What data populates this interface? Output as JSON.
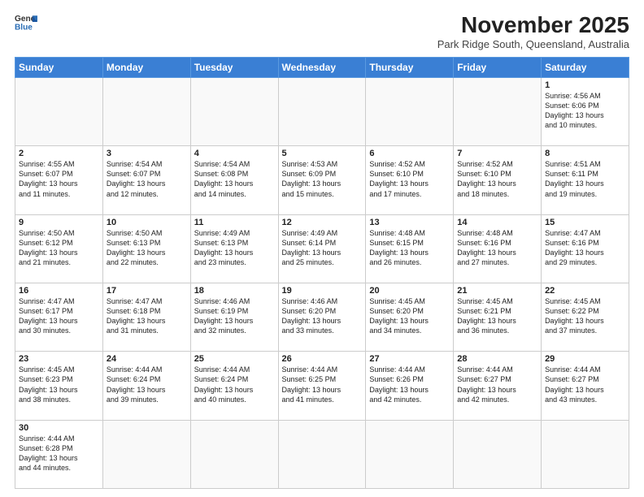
{
  "header": {
    "logo_general": "General",
    "logo_blue": "Blue",
    "month_title": "November 2025",
    "location": "Park Ridge South, Queensland, Australia"
  },
  "weekdays": [
    "Sunday",
    "Monday",
    "Tuesday",
    "Wednesday",
    "Thursday",
    "Friday",
    "Saturday"
  ],
  "weeks": [
    [
      {
        "day": "",
        "info": ""
      },
      {
        "day": "",
        "info": ""
      },
      {
        "day": "",
        "info": ""
      },
      {
        "day": "",
        "info": ""
      },
      {
        "day": "",
        "info": ""
      },
      {
        "day": "",
        "info": ""
      },
      {
        "day": "1",
        "info": "Sunrise: 4:56 AM\nSunset: 6:06 PM\nDaylight: 13 hours\nand 10 minutes."
      }
    ],
    [
      {
        "day": "2",
        "info": "Sunrise: 4:55 AM\nSunset: 6:07 PM\nDaylight: 13 hours\nand 11 minutes."
      },
      {
        "day": "3",
        "info": "Sunrise: 4:54 AM\nSunset: 6:07 PM\nDaylight: 13 hours\nand 12 minutes."
      },
      {
        "day": "4",
        "info": "Sunrise: 4:54 AM\nSunset: 6:08 PM\nDaylight: 13 hours\nand 14 minutes."
      },
      {
        "day": "5",
        "info": "Sunrise: 4:53 AM\nSunset: 6:09 PM\nDaylight: 13 hours\nand 15 minutes."
      },
      {
        "day": "6",
        "info": "Sunrise: 4:52 AM\nSunset: 6:10 PM\nDaylight: 13 hours\nand 17 minutes."
      },
      {
        "day": "7",
        "info": "Sunrise: 4:52 AM\nSunset: 6:10 PM\nDaylight: 13 hours\nand 18 minutes."
      },
      {
        "day": "8",
        "info": "Sunrise: 4:51 AM\nSunset: 6:11 PM\nDaylight: 13 hours\nand 19 minutes."
      }
    ],
    [
      {
        "day": "9",
        "info": "Sunrise: 4:50 AM\nSunset: 6:12 PM\nDaylight: 13 hours\nand 21 minutes."
      },
      {
        "day": "10",
        "info": "Sunrise: 4:50 AM\nSunset: 6:13 PM\nDaylight: 13 hours\nand 22 minutes."
      },
      {
        "day": "11",
        "info": "Sunrise: 4:49 AM\nSunset: 6:13 PM\nDaylight: 13 hours\nand 23 minutes."
      },
      {
        "day": "12",
        "info": "Sunrise: 4:49 AM\nSunset: 6:14 PM\nDaylight: 13 hours\nand 25 minutes."
      },
      {
        "day": "13",
        "info": "Sunrise: 4:48 AM\nSunset: 6:15 PM\nDaylight: 13 hours\nand 26 minutes."
      },
      {
        "day": "14",
        "info": "Sunrise: 4:48 AM\nSunset: 6:16 PM\nDaylight: 13 hours\nand 27 minutes."
      },
      {
        "day": "15",
        "info": "Sunrise: 4:47 AM\nSunset: 6:16 PM\nDaylight: 13 hours\nand 29 minutes."
      }
    ],
    [
      {
        "day": "16",
        "info": "Sunrise: 4:47 AM\nSunset: 6:17 PM\nDaylight: 13 hours\nand 30 minutes."
      },
      {
        "day": "17",
        "info": "Sunrise: 4:47 AM\nSunset: 6:18 PM\nDaylight: 13 hours\nand 31 minutes."
      },
      {
        "day": "18",
        "info": "Sunrise: 4:46 AM\nSunset: 6:19 PM\nDaylight: 13 hours\nand 32 minutes."
      },
      {
        "day": "19",
        "info": "Sunrise: 4:46 AM\nSunset: 6:20 PM\nDaylight: 13 hours\nand 33 minutes."
      },
      {
        "day": "20",
        "info": "Sunrise: 4:45 AM\nSunset: 6:20 PM\nDaylight: 13 hours\nand 34 minutes."
      },
      {
        "day": "21",
        "info": "Sunrise: 4:45 AM\nSunset: 6:21 PM\nDaylight: 13 hours\nand 36 minutes."
      },
      {
        "day": "22",
        "info": "Sunrise: 4:45 AM\nSunset: 6:22 PM\nDaylight: 13 hours\nand 37 minutes."
      }
    ],
    [
      {
        "day": "23",
        "info": "Sunrise: 4:45 AM\nSunset: 6:23 PM\nDaylight: 13 hours\nand 38 minutes."
      },
      {
        "day": "24",
        "info": "Sunrise: 4:44 AM\nSunset: 6:24 PM\nDaylight: 13 hours\nand 39 minutes."
      },
      {
        "day": "25",
        "info": "Sunrise: 4:44 AM\nSunset: 6:24 PM\nDaylight: 13 hours\nand 40 minutes."
      },
      {
        "day": "26",
        "info": "Sunrise: 4:44 AM\nSunset: 6:25 PM\nDaylight: 13 hours\nand 41 minutes."
      },
      {
        "day": "27",
        "info": "Sunrise: 4:44 AM\nSunset: 6:26 PM\nDaylight: 13 hours\nand 42 minutes."
      },
      {
        "day": "28",
        "info": "Sunrise: 4:44 AM\nSunset: 6:27 PM\nDaylight: 13 hours\nand 42 minutes."
      },
      {
        "day": "29",
        "info": "Sunrise: 4:44 AM\nSunset: 6:27 PM\nDaylight: 13 hours\nand 43 minutes."
      }
    ],
    [
      {
        "day": "30",
        "info": "Sunrise: 4:44 AM\nSunset: 6:28 PM\nDaylight: 13 hours\nand 44 minutes."
      },
      {
        "day": "",
        "info": ""
      },
      {
        "day": "",
        "info": ""
      },
      {
        "day": "",
        "info": ""
      },
      {
        "day": "",
        "info": ""
      },
      {
        "day": "",
        "info": ""
      },
      {
        "day": "",
        "info": ""
      }
    ]
  ]
}
